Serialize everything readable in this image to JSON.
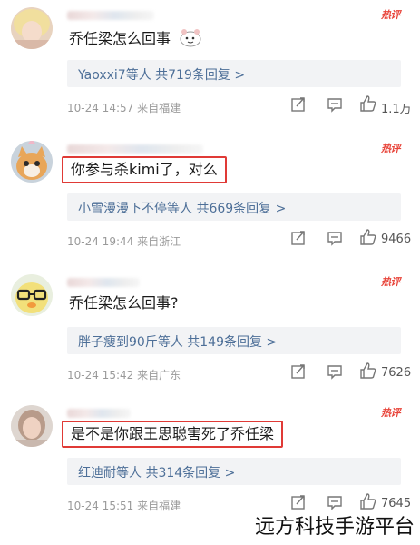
{
  "comments": [
    {
      "text": "乔任梁怎么回事",
      "sticker": "sticker-icon",
      "hot_label": "热评",
      "replies": "Yaoxxi7等人 共719条回复 >",
      "time_location": "10-24 14:57 来自福建",
      "likes": "1.1万",
      "avatar": "blonde-girl-avatar",
      "highlighted": false
    },
    {
      "text": "你参与杀kimi了，对么",
      "hot_label": "热评",
      "replies": "小雪漫漫下不停等人 共669条回复 >",
      "time_location": "10-24 19:44 来自浙江",
      "likes": "9466",
      "avatar": "cat-avatar",
      "highlighted": true
    },
    {
      "text": "乔任梁怎么回事?",
      "hot_label": "热评",
      "replies": "胖子瘦到90斤等人 共149条回复 >",
      "time_location": "10-24 15:42 来自广东",
      "likes": "7626",
      "avatar": "duck-glasses-avatar",
      "highlighted": false
    },
    {
      "text": "是不是你跟王思聪害死了乔任梁",
      "hot_label": "热评",
      "replies": "红迪耐等人 共314条回复 >",
      "time_location": "10-24 15:51 来自福建",
      "likes": "7645",
      "avatar": "girl-photo-avatar",
      "highlighted": true
    }
  ],
  "watermark": "远方科技手游平台",
  "colors": {
    "hot": "#e8443a",
    "highlight_box": "#e03a36",
    "link": "#4d6f98",
    "reply_bg": "#f2f3f5",
    "meta": "#9a9a9a"
  }
}
